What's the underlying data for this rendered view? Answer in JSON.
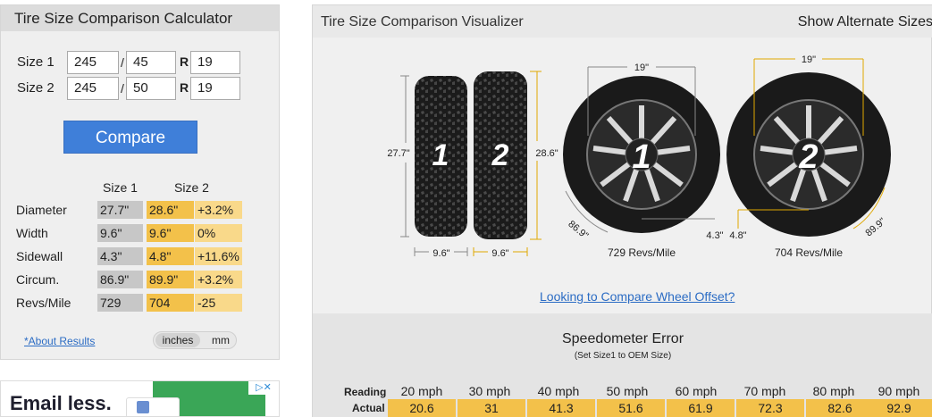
{
  "calculator": {
    "title": "Tire Size Comparison Calculator",
    "size1": {
      "label": "Size 1",
      "width": "245",
      "aspect": "45",
      "r": "R",
      "rim": "19"
    },
    "size2": {
      "label": "Size 2",
      "width": "245",
      "aspect": "50",
      "r": "R",
      "rim": "19"
    },
    "slash": "/",
    "compare_label": "Compare",
    "results": {
      "col_size1": "Size 1",
      "col_size2": "Size 2",
      "rows": [
        {
          "label": "Diameter",
          "s1": "27.7\"",
          "s2": "28.6\"",
          "diff": "+3.2%"
        },
        {
          "label": "Width",
          "s1": "9.6\"",
          "s2": "9.6\"",
          "diff": "0%"
        },
        {
          "label": "Sidewall",
          "s1": "4.3\"",
          "s2": "4.8\"",
          "diff": "+11.6%"
        },
        {
          "label": "Circum.",
          "s1": "86.9\"",
          "s2": "89.9\"",
          "diff": "+3.2%"
        },
        {
          "label": "Revs/Mile",
          "s1": "729",
          "s2": "704",
          "diff": "-25"
        }
      ]
    },
    "about_link": "*About Results",
    "units": {
      "inches": "inches",
      "mm": "mm",
      "selected": "inches"
    }
  },
  "ad": {
    "headline": "Email less.",
    "close_icon": "ad-choices-icon"
  },
  "visualizer": {
    "title": "Tire Size Comparison Visualizer",
    "alt_link": "Show Alternate Sizes",
    "tire1": {
      "number": "1",
      "height": "27.7\"",
      "width": "9.6\""
    },
    "tire2": {
      "number": "2",
      "height": "28.6\"",
      "width": "9.6\""
    },
    "wheel1": {
      "number": "1",
      "rim": "19\"",
      "sidewall": "4.3\"",
      "circum": "86.9\"",
      "revs": "729 Revs/Mile"
    },
    "wheel2": {
      "number": "2",
      "rim": "19\"",
      "sidewall": "4.8\"",
      "circum": "89.9\"",
      "revs": "704 Revs/Mile"
    },
    "offset_link": "Looking to Compare Wheel Offset?"
  },
  "speedometer": {
    "title": "Speedometer Error",
    "subtitle": "(Set Size1 to OEM Size)",
    "reading_label": "Reading",
    "actual_label": "Actual",
    "readings": [
      "20 mph",
      "30 mph",
      "40 mph",
      "50 mph",
      "60 mph",
      "70 mph",
      "80 mph",
      "90 mph"
    ],
    "actuals": [
      "20.6",
      "31",
      "41.3",
      "51.6",
      "61.9",
      "72.3",
      "82.6",
      "92.9"
    ]
  },
  "colors": {
    "accent": "#3f7fd9",
    "size1_cell": "#c7c7c7",
    "size2_cell": "#f3c14a",
    "diff_cell": "#f9d98a",
    "link": "#2b6cc4"
  }
}
